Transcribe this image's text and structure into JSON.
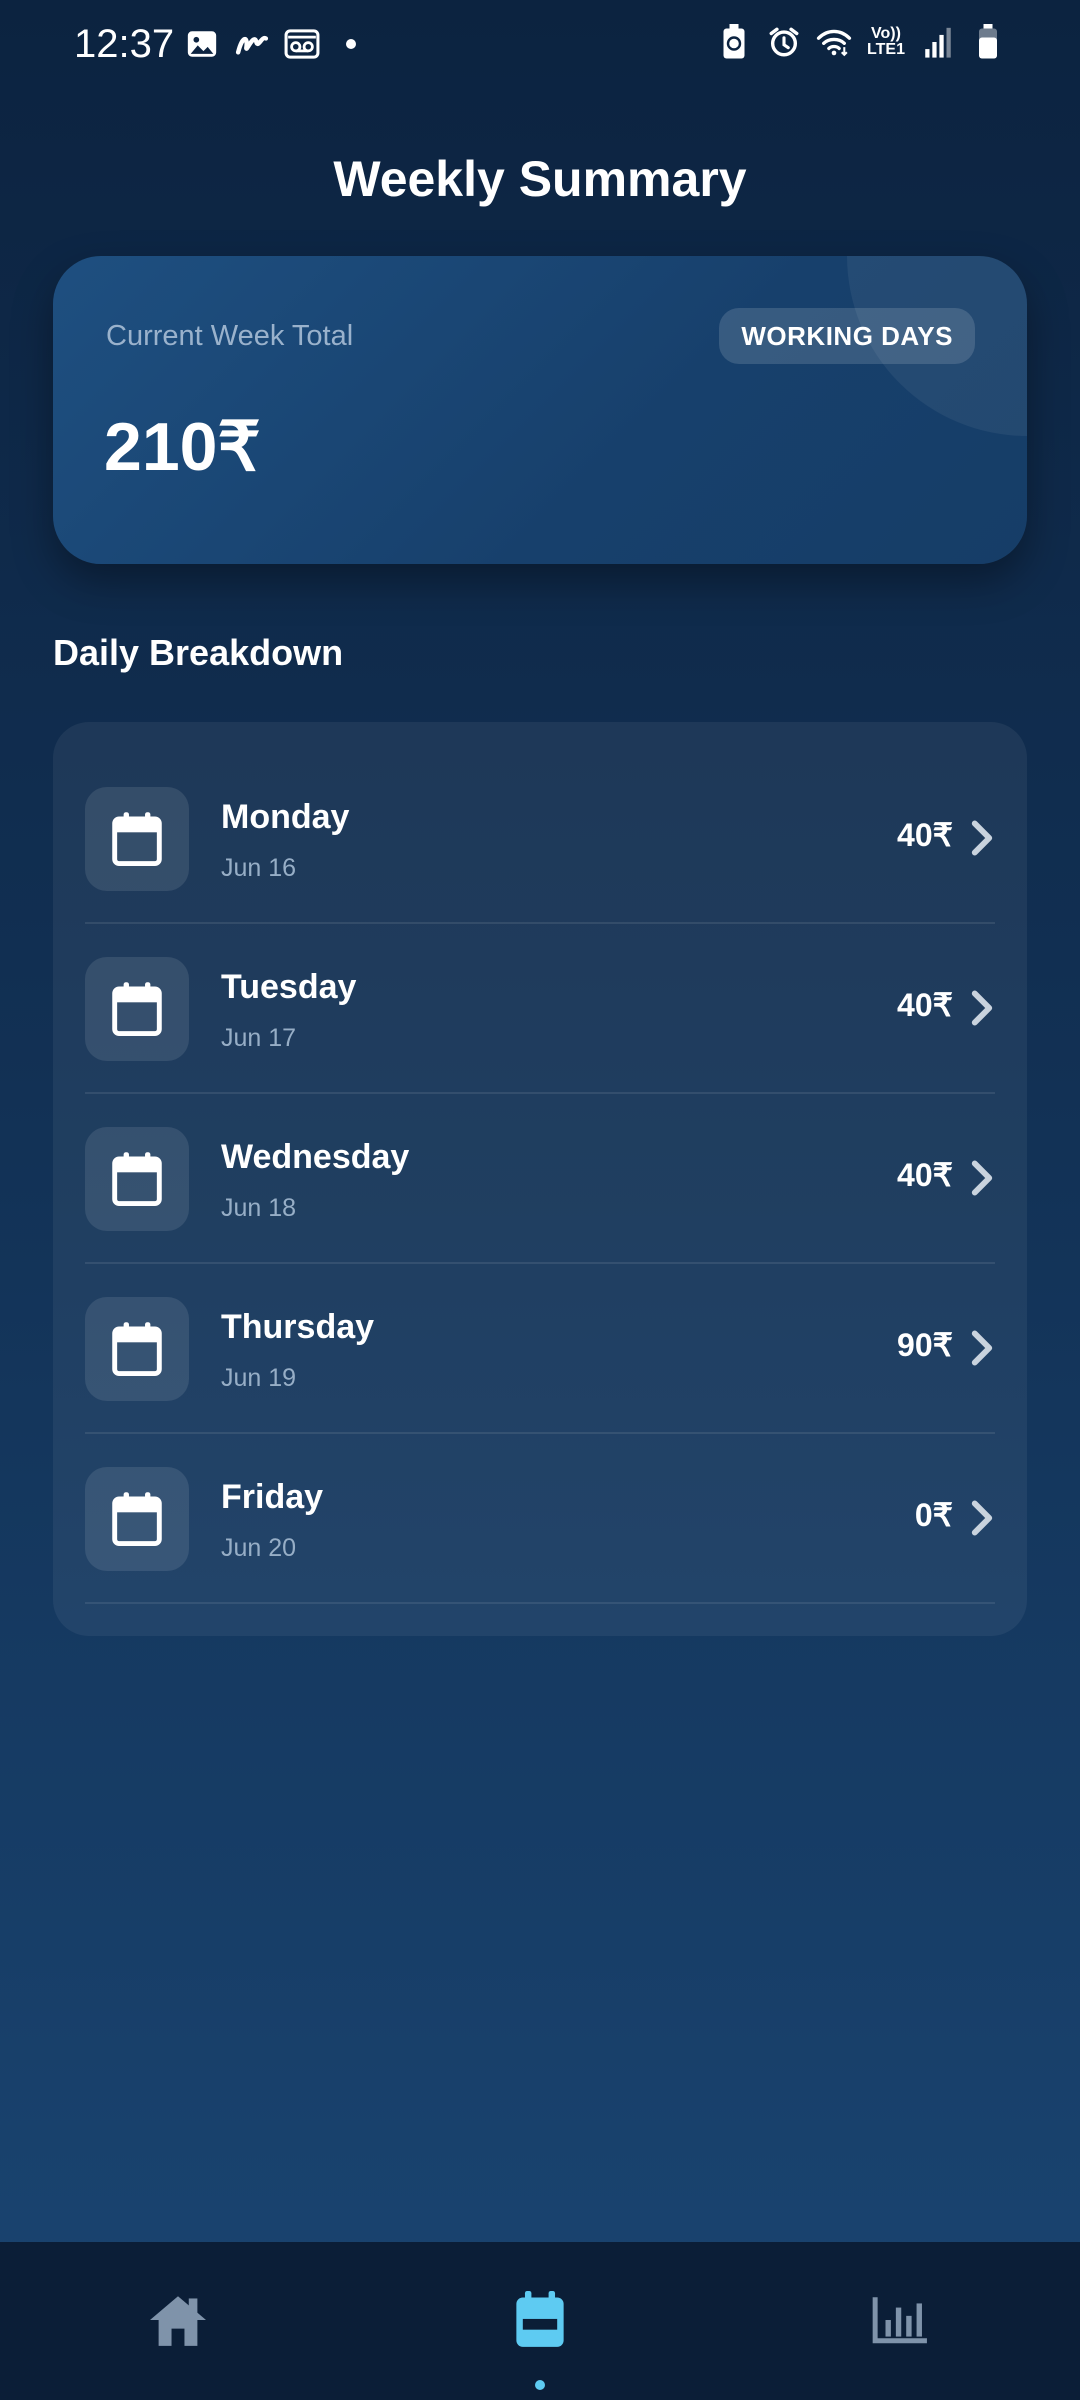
{
  "status_bar": {
    "time": "12:37",
    "left_icons": [
      "gallery-icon",
      "gesture-icon",
      "voicemail-icon"
    ],
    "right_icons": [
      "battery-saver-icon",
      "alarm-icon",
      "wifi-icon",
      "volte-lte-icon",
      "signal-icon",
      "battery-icon"
    ],
    "volte_text": "Vo))",
    "lte_text": "LTE1"
  },
  "page": {
    "title": "Weekly Summary"
  },
  "summary": {
    "label": "Current Week Total",
    "badge": "WORKING DAYS",
    "total": "210₹"
  },
  "breakdown": {
    "title": "Daily Breakdown",
    "days": [
      {
        "name": "Monday",
        "date": "Jun 16",
        "amount": "40₹"
      },
      {
        "name": "Tuesday",
        "date": "Jun 17",
        "amount": "40₹"
      },
      {
        "name": "Wednesday",
        "date": "Jun 18",
        "amount": "40₹"
      },
      {
        "name": "Thursday",
        "date": "Jun 19",
        "amount": "90₹"
      },
      {
        "name": "Friday",
        "date": "Jun 20",
        "amount": "0₹"
      }
    ]
  },
  "bottom_nav": {
    "items": [
      {
        "icon": "home-icon",
        "active": false
      },
      {
        "icon": "calendar-icon",
        "active": true
      },
      {
        "icon": "bar-chart-icon",
        "active": false
      }
    ],
    "active_color": "#5ecbf2",
    "inactive_color": "#7f93aa"
  }
}
